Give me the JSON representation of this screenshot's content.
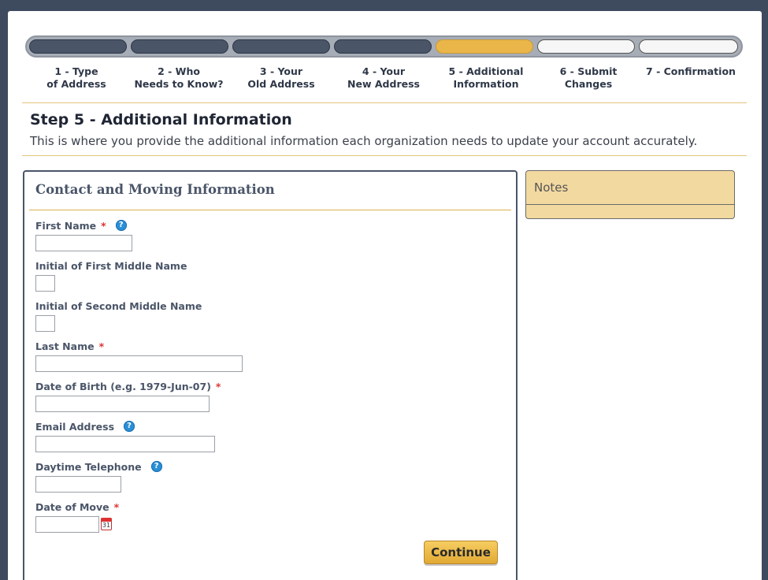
{
  "steps": [
    {
      "label": "1 - Type\nof Address",
      "state": "done"
    },
    {
      "label": "2 - Who\nNeeds to Know?",
      "state": "done"
    },
    {
      "label": "3 - Your\nOld Address",
      "state": "done"
    },
    {
      "label": "4 - Your\nNew Address",
      "state": "done"
    },
    {
      "label": "5 - Additional\nInformation",
      "state": "active"
    },
    {
      "label": "6 - Submit\nChanges",
      "state": "todo"
    },
    {
      "label": "7 - Confirmation",
      "state": "todo"
    }
  ],
  "step_heading": "Step 5 - Additional Information",
  "step_description": "This is where you provide the additional information each organization needs to update your account accurately.",
  "form": {
    "title": "Contact and Moving Information",
    "fields": {
      "first_name": {
        "label": "First Name",
        "required": "*",
        "value": ""
      },
      "initial_first_middle": {
        "label": "Initial of First Middle Name",
        "value": ""
      },
      "initial_second_middle": {
        "label": "Initial of Second Middle Name",
        "value": ""
      },
      "last_name": {
        "label": "Last Name",
        "required": "*",
        "value": ""
      },
      "dob": {
        "label": "Date of Birth (e.g. 1979-Jun-07)",
        "required": "*",
        "value": ""
      },
      "email": {
        "label": "Email Address",
        "value": ""
      },
      "phone": {
        "label": "Daytime Telephone",
        "value": ""
      },
      "move_date": {
        "label": "Date of Move",
        "required": "*",
        "value": ""
      }
    },
    "help_glyph": "?",
    "calendar_day": "31",
    "continue_label": "Continue"
  },
  "notes": {
    "title": "Notes"
  },
  "colors": {
    "done": "#4a5568",
    "active": "#eab64a",
    "required": "#dd3333",
    "help": "#2a8fd6"
  }
}
